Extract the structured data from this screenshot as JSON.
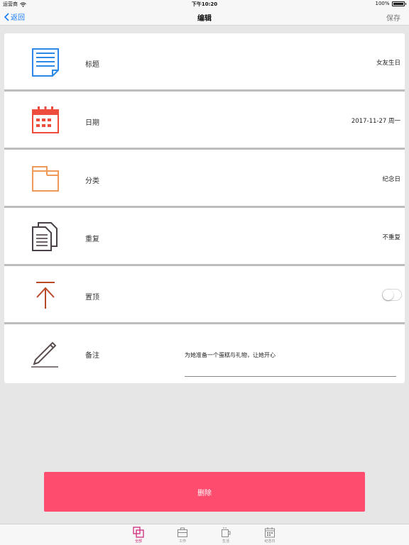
{
  "status": {
    "carrier": "运营商",
    "time": "下午10:20",
    "battery": "100%"
  },
  "nav": {
    "back_label": "返回",
    "title": "编辑",
    "save_label": "保存"
  },
  "rows": [
    {
      "label": "标题",
      "value": "女友生日",
      "icon": "document-icon"
    },
    {
      "label": "日期",
      "value": "2017-11-27 周一",
      "icon": "calendar-icon"
    },
    {
      "label": "分类",
      "value": "纪念日",
      "icon": "folder-icon"
    },
    {
      "label": "重复",
      "value": "不重复",
      "icon": "copy-icon"
    },
    {
      "label": "置顶",
      "value": "",
      "icon": "pin-top-icon",
      "toggle_on": false
    },
    {
      "label": "备注",
      "value": "为她准备一个蛋糕与礼物，让她开心",
      "icon": "pencil-icon"
    }
  ],
  "delete_label": "删除",
  "tabs": [
    {
      "label": "全部",
      "active": true,
      "icon": "all-icon"
    },
    {
      "label": "工作",
      "active": false,
      "icon": "briefcase-icon"
    },
    {
      "label": "生活",
      "active": false,
      "icon": "cup-icon"
    },
    {
      "label": "纪念日",
      "active": false,
      "icon": "calendar-icon"
    }
  ],
  "colors": {
    "accent_blue": "#1a7cf4",
    "delete_red": "#fd4c6e",
    "tab_active": "#d12b7b",
    "icon_blue": "#2c8ae6",
    "icon_red": "#ee4d3d",
    "icon_orange": "#ee9a5a",
    "icon_dark": "#4a4048",
    "icon_rust": "#b84a2a"
  }
}
